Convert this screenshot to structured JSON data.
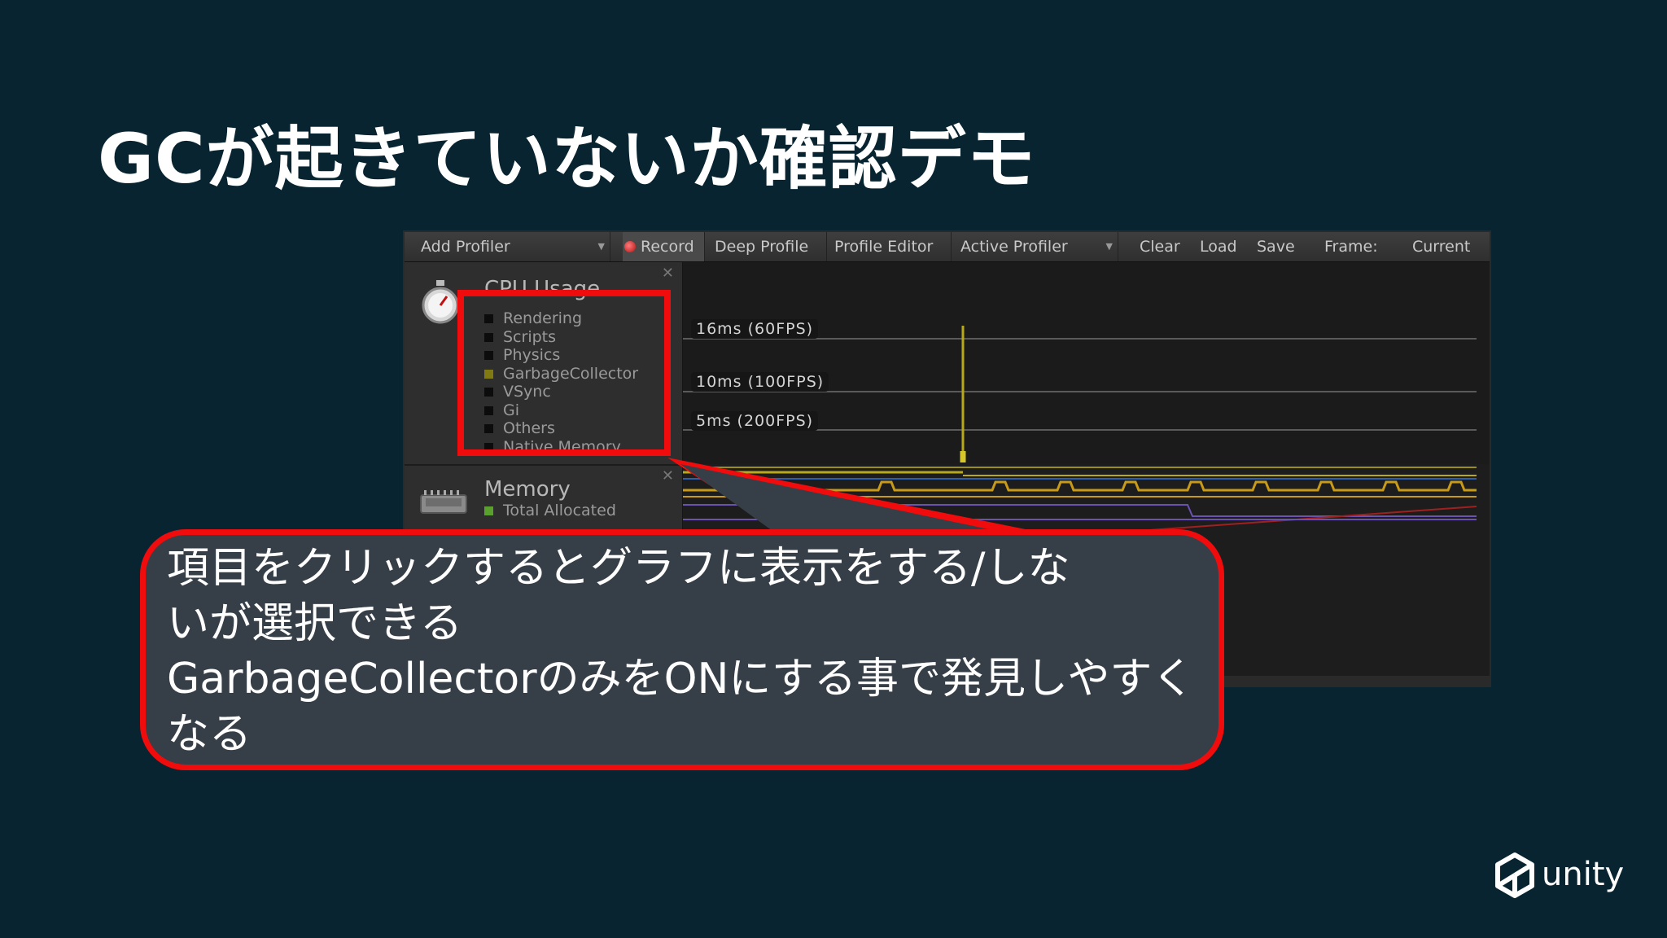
{
  "slide": {
    "title": "GCが起きていないか確認デモ",
    "brand": "unity"
  },
  "toolbar": {
    "add_profiler": "Add Profiler",
    "record": "Record",
    "deep_profile": "Deep Profile",
    "profile_editor": "Profile Editor",
    "active_profiler": "Active Profiler",
    "clear": "Clear",
    "load": "Load",
    "save": "Save",
    "frame": "Frame:",
    "current": "Current"
  },
  "cpu_module": {
    "title": "CPU Usage",
    "legend": [
      {
        "label": "Rendering",
        "color": "#0c0c0c"
      },
      {
        "label": "Scripts",
        "color": "#0c0c0c"
      },
      {
        "label": "Physics",
        "color": "#0c0c0c"
      },
      {
        "label": "GarbageCollector",
        "color": "#7f7a12"
      },
      {
        "label": "VSync",
        "color": "#0c0c0c"
      },
      {
        "label": "Gi",
        "color": "#0c0c0c"
      },
      {
        "label": "Others",
        "color": "#0c0c0c"
      },
      {
        "label": "Native Memory",
        "color": "#0c0c0c"
      }
    ]
  },
  "memory_module": {
    "title": "Memory",
    "legend_first": "Total Allocated",
    "legend_first_color": "#5aa02c"
  },
  "graph": {
    "fps_labels": [
      "16ms (60FPS)",
      "10ms (100FPS)",
      "5ms (200FPS)"
    ]
  },
  "callout": {
    "lines": [
      "項目をクリックするとグラフに表示をする/しな",
      "いが選択できる",
      "GarbageCollectorのみをONにする事で発見しやすく",
      "なる"
    ]
  },
  "colors": {
    "background": "#082431",
    "highlight": "#f00c0c",
    "callout_fill": "#363f47",
    "gc_line": "#b8a81c"
  }
}
